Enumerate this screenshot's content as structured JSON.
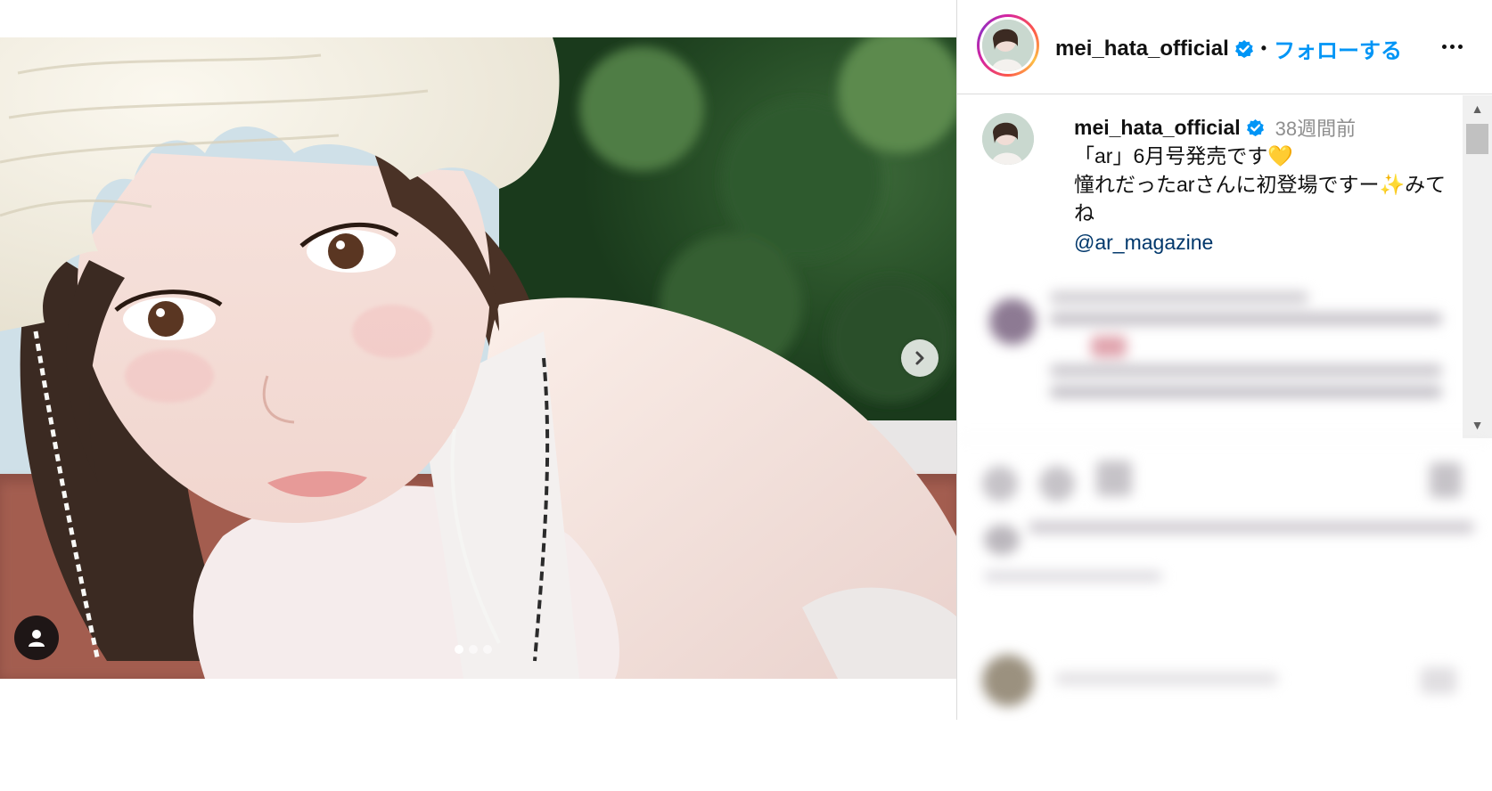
{
  "post": {
    "author": "mei_hata_official",
    "follow_label": "フォローする",
    "bullet": "•",
    "caption": {
      "username": "mei_hata_official",
      "time_ago": "38週間前",
      "text": "「ar」6月号発売です💛\n憧れだったarさんに初登場ですー✨みてね",
      "mention": "@ar_magazine"
    },
    "carousel": {
      "total": 3,
      "current": 1
    }
  },
  "icons": {
    "next": "chevron-right-icon",
    "tag": "user-tag-icon",
    "more": "more-options-icon",
    "verified": "verified-badge-icon"
  },
  "colors": {
    "follow": "#0095f6",
    "mention": "#00376b",
    "verified": "#0095f6"
  }
}
